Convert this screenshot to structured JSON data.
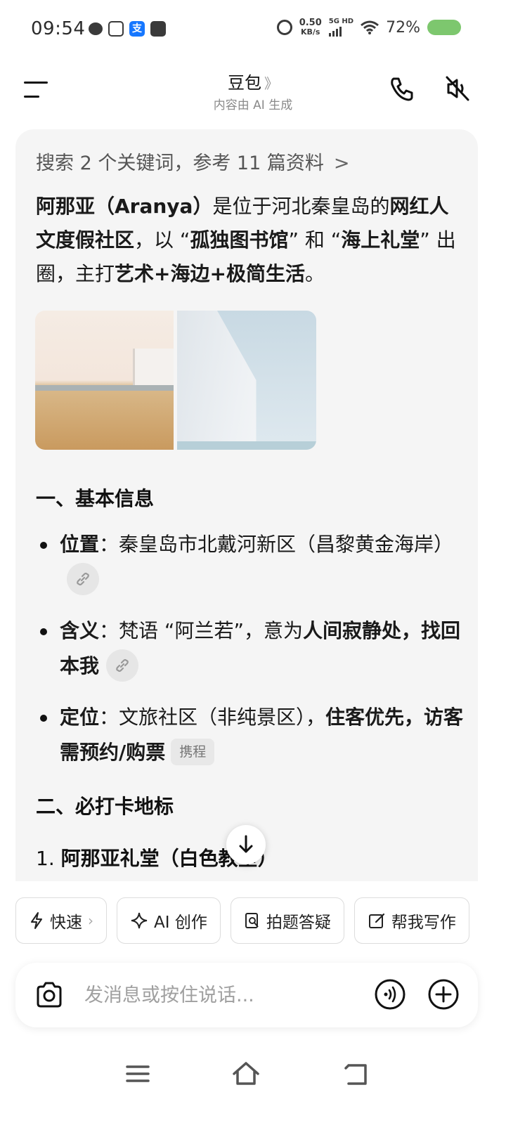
{
  "status_bar": {
    "time": "09:54",
    "net_speed_value": "0.50",
    "net_speed_unit": "KB/s",
    "network_type": "5G HD",
    "battery_percent": "72%",
    "battery_color": "#7dc76e",
    "icons": [
      "chat-bubble-icon",
      "camera-app-icon",
      "alipay-icon",
      "transit-icon",
      "alarm-icon",
      "signal-icon",
      "wifi-icon",
      "battery-icon"
    ]
  },
  "header": {
    "title": "豆包",
    "title_chevron": "》",
    "subtitle": "内容由 AI 生成"
  },
  "answer": {
    "search_summary": "搜索 2 个关键词，参考 11 篇资料",
    "search_chevron": ">",
    "intro": {
      "p1": "阿那亚（Aranya）",
      "p2": "是位于河北秦皇岛的",
      "p3": "网红人文度假社区",
      "p4": "，以 “",
      "p5": "孤独图书馆",
      "p6": "” 和 “",
      "p7": "海上礼堂",
      "p8": "” 出圈，主打",
      "p9": "艺术+海边+极简生活",
      "p10": "。"
    },
    "section1_title": "一、基本信息",
    "bullets": [
      {
        "label": "位置",
        "sep": "：",
        "text": "秦皇岛市北戴河新区（昌黎黄金海岸）"
      },
      {
        "label": "含义",
        "sep": "：",
        "text": "梵语 “阿兰若”，意为",
        "bold": "人间寂静处，找回本我"
      },
      {
        "label": "定位",
        "sep": "：",
        "text": "文旅社区（非纯景区），",
        "bold": "住客优先，访客需预约/购票",
        "source": "携程"
      }
    ],
    "section2_title": "二、必打卡地标",
    "numbered_1_num": "1.",
    "numbered_1_text": "阿那亚礼堂（白色教堂）"
  },
  "quick_actions": [
    {
      "label": "快速",
      "icon": "lightning-icon",
      "chevron": "›"
    },
    {
      "label": "AI 创作",
      "icon": "sparkle-icon"
    },
    {
      "label": "拍题答疑",
      "icon": "photo-search-icon"
    },
    {
      "label": "帮我写作",
      "icon": "edit-icon"
    }
  ],
  "input": {
    "placeholder": "发消息或按住说话...",
    "value": ""
  }
}
